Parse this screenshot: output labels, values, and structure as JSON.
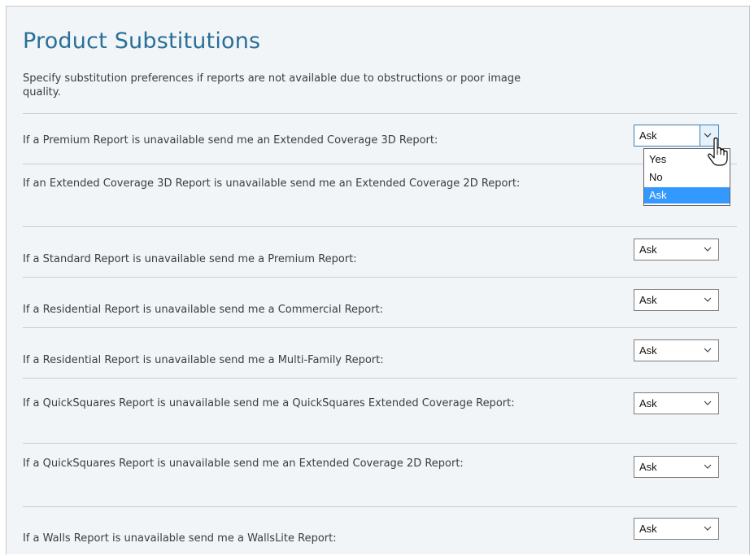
{
  "title": "Product Substitutions",
  "description": "Specify substitution preferences if reports are not available due to obstructions or poor image quality.",
  "rows": [
    {
      "label": "If a Premium Report is unavailable send me an Extended Coverage 3D Report:",
      "value": "Ask"
    },
    {
      "label": "If an Extended Coverage 3D Report is unavailable send me an Extended Coverage 2D Report:",
      "value": "Ask"
    },
    {
      "label": "If a Standard Report is unavailable send me a Premium Report:",
      "value": "Ask"
    },
    {
      "label": "If a Residential Report is unavailable send me a Commercial Report:",
      "value": "Ask"
    },
    {
      "label": "If a Residential Report is unavailable send me a Multi-Family Report:",
      "value": "Ask"
    },
    {
      "label": "If a QuickSquares Report is unavailable send me a QuickSquares Extended Coverage Report:",
      "value": "Ask"
    },
    {
      "label": "If a QuickSquares Report is unavailable send me an Extended Coverage 2D Report:",
      "value": "Ask"
    },
    {
      "label": "If a Walls Report is unavailable send me a WallsLite Report:",
      "value": "Ask"
    }
  ],
  "dropdown": {
    "options": [
      "Yes",
      "No",
      "Ask"
    ],
    "selected": "Ask"
  },
  "colors": {
    "title": "#2a6f97",
    "panel_bg": "#f1f5f8",
    "selection": "#3399ff"
  }
}
